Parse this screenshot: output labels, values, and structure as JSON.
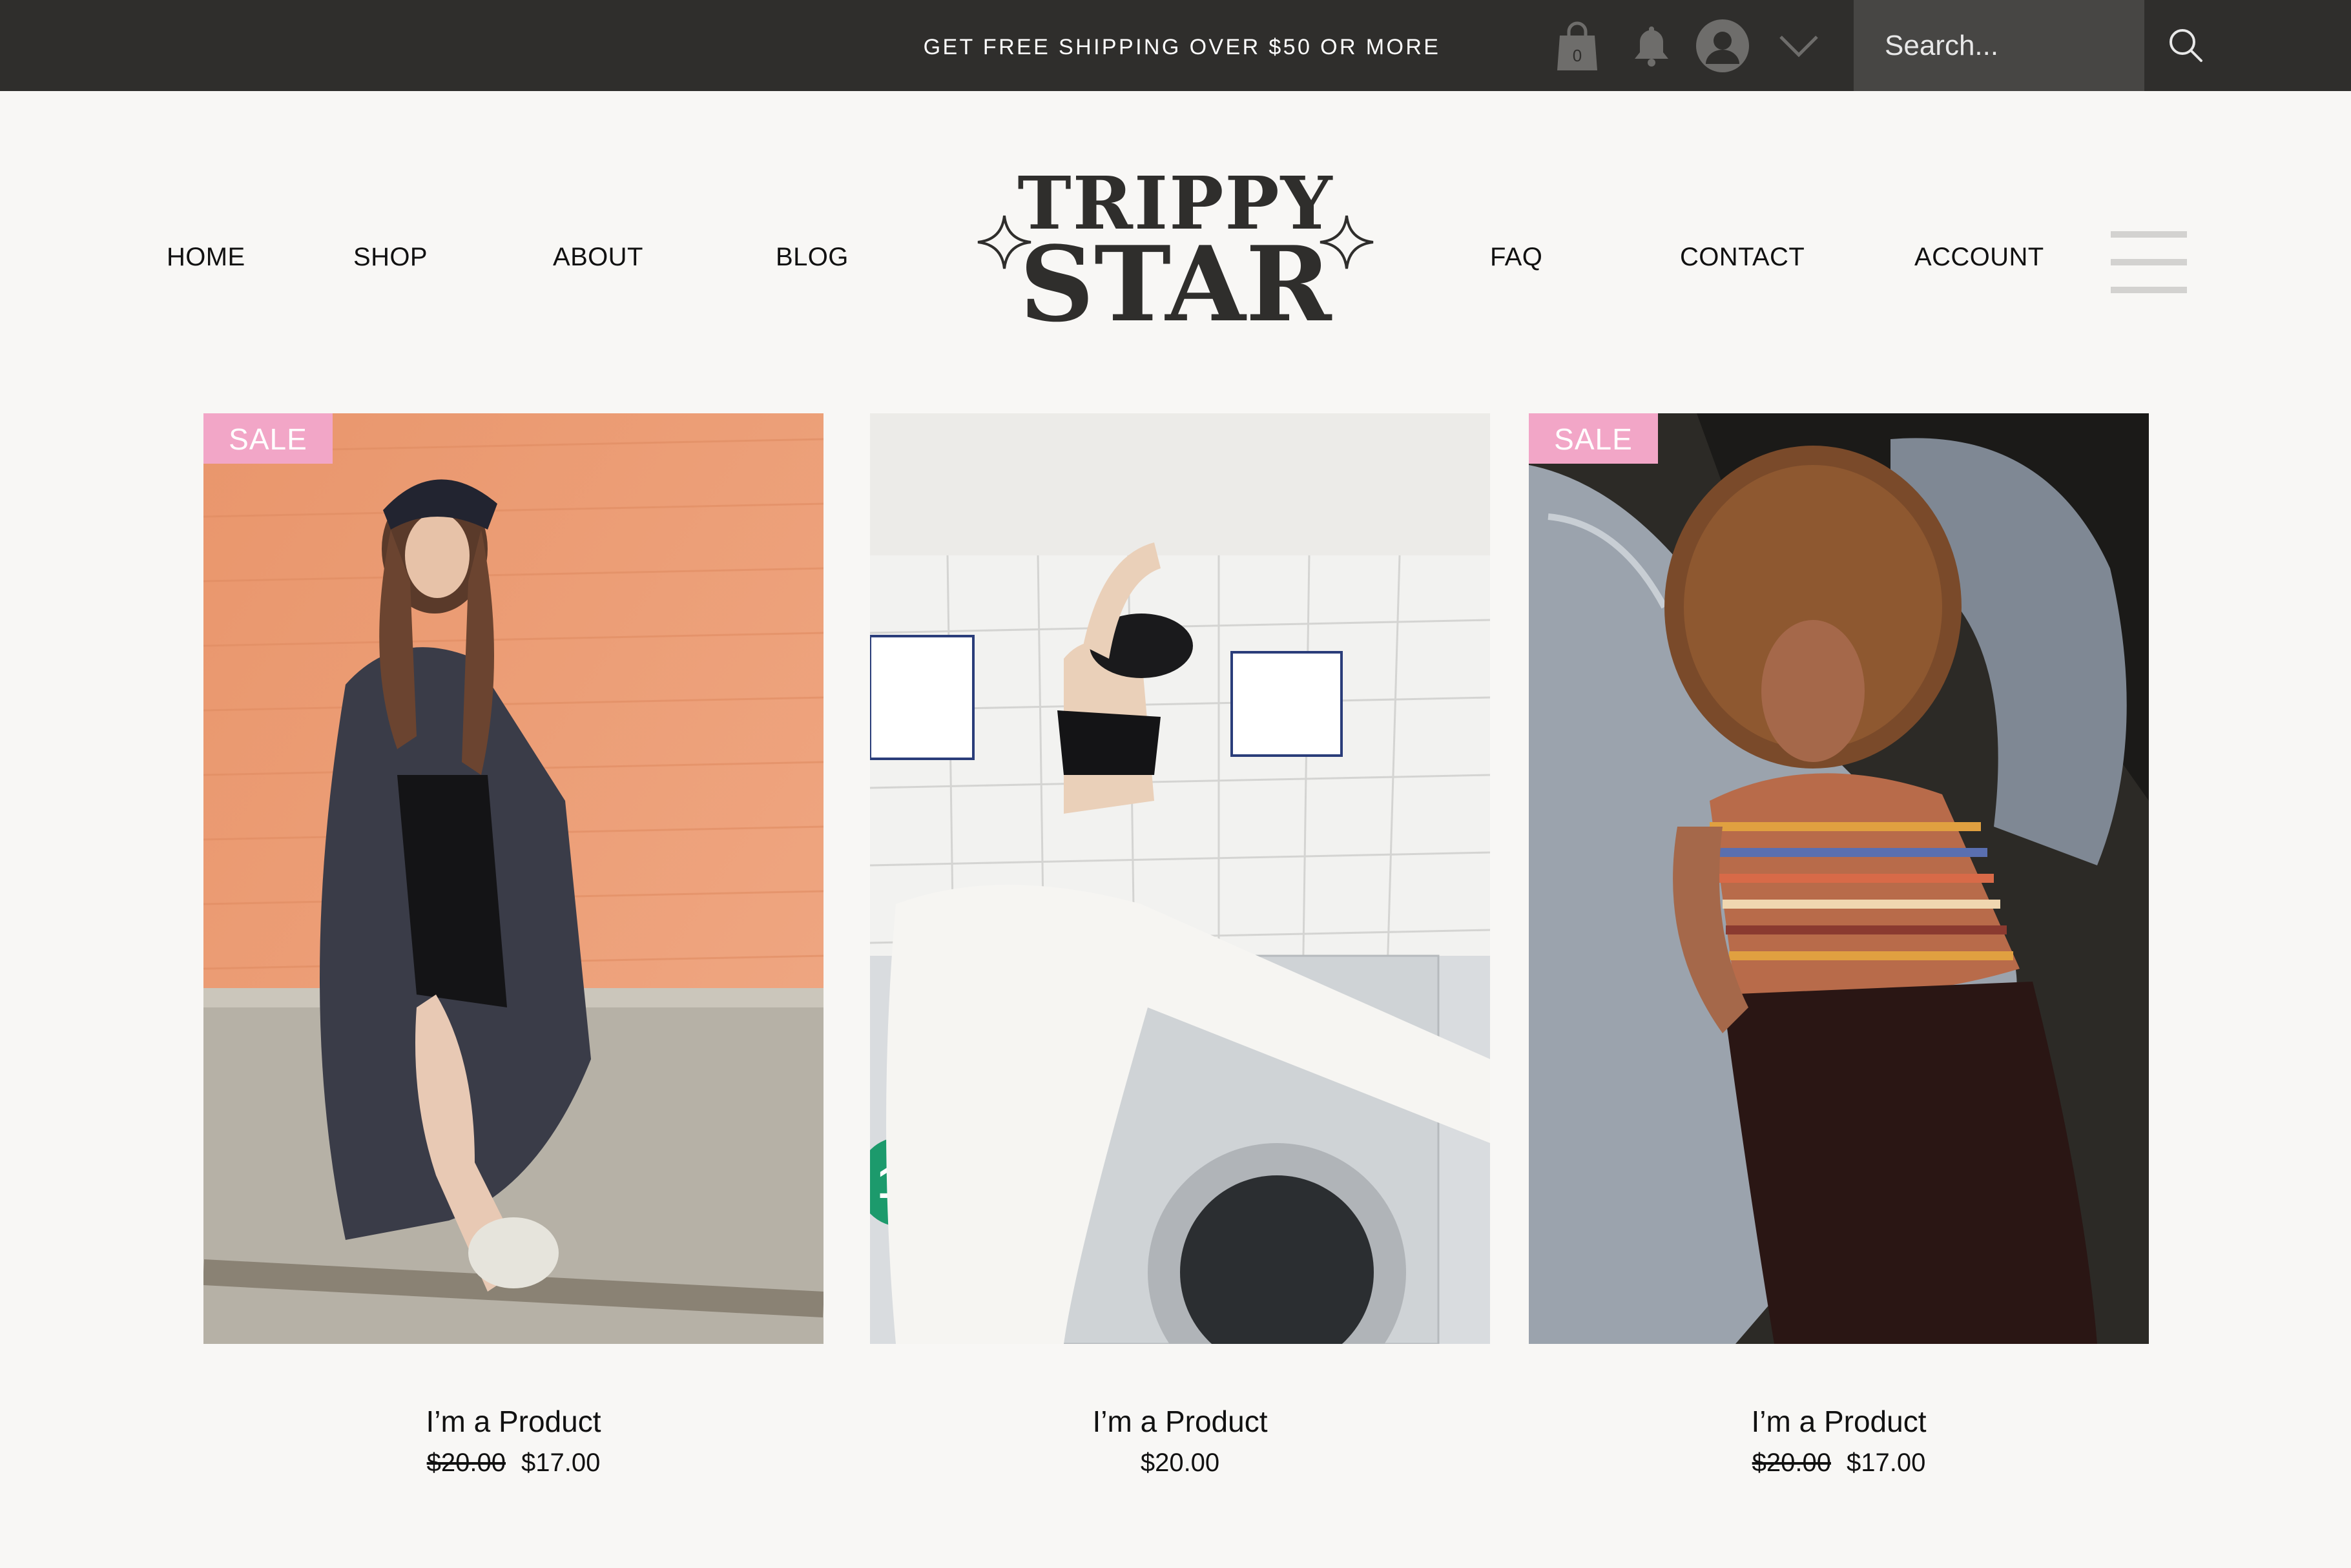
{
  "topbar": {
    "promo": "GET FREE SHIPPING OVER $50 OR MORE",
    "cart_count": "0",
    "icons": [
      "shopping-bag-icon",
      "bell-icon",
      "user-avatar-icon",
      "chevron-down-icon",
      "search-icon"
    ],
    "search_placeholder": "Search..."
  },
  "nav": {
    "left": [
      "HOME",
      "SHOP",
      "ABOUT",
      "BLOG"
    ],
    "right": [
      "FAQ",
      "CONTACT",
      "ACCOUNT"
    ]
  },
  "logo": {
    "line1": "TRIPPY",
    "line2": "STAR"
  },
  "colors": {
    "topbar": "#2f2e2c",
    "sale_badge": "#f2a6c7",
    "background": "#f8f7f5"
  },
  "products": [
    {
      "badge": "SALE",
      "name": "I’m a Product",
      "old_price": "$20.00",
      "price": "$17.00"
    },
    {
      "badge": "",
      "name": "I’m a Product",
      "old_price": "",
      "price": "$20.00"
    },
    {
      "badge": "SALE",
      "name": "I’m a Product",
      "old_price": "$20.00",
      "price": "$17.00"
    }
  ]
}
